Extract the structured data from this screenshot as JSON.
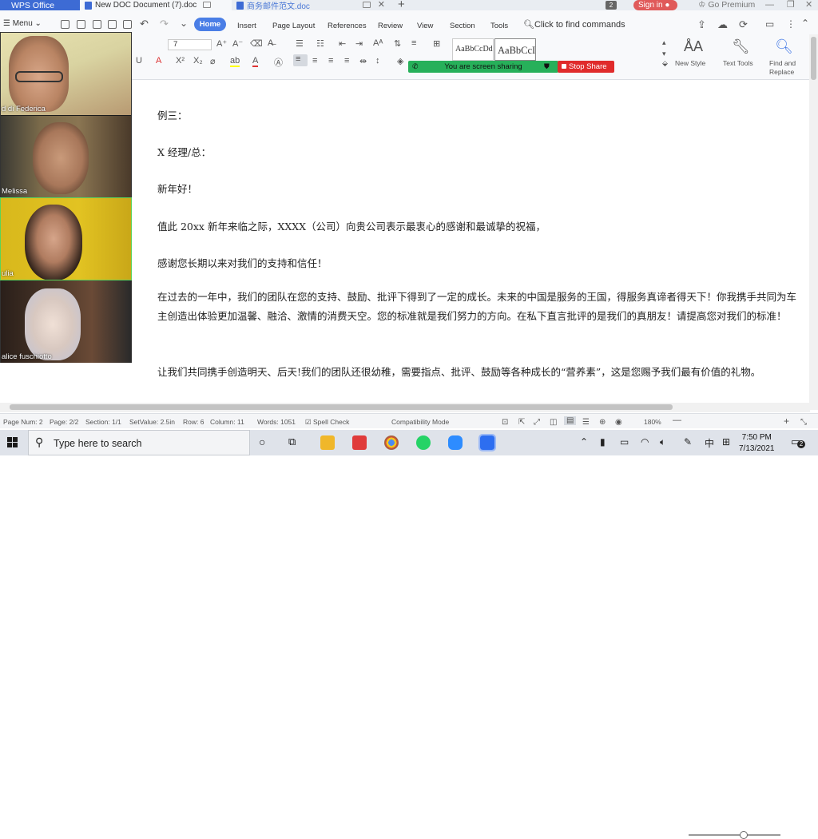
{
  "titlebar": {
    "tabs": [
      {
        "label": "WPS Office"
      },
      {
        "label": "New DOC Document (7).doc"
      },
      {
        "label": "商务邮件范文.doc"
      }
    ],
    "counter_badge": "2",
    "sign_in": "Sign in",
    "premium": "Go Premium"
  },
  "ribbon": {
    "menu_label": "Menu",
    "tabs": [
      "Home",
      "Insert",
      "Page Layout",
      "References",
      "Review",
      "View",
      "Section",
      "Tools"
    ],
    "search_commands": "Click to find commands",
    "font_size": "7",
    "style_samples": [
      "AaBbCcDd",
      "AaBbCcI"
    ],
    "new_style": "New Style",
    "text_tools": "Text Tools",
    "find_replace": [
      "Find and",
      "Replace"
    ]
  },
  "share": {
    "status_text": "You are screen sharing",
    "stop_label": "Stop Share"
  },
  "video_panel": {
    "participants": [
      {
        "name": "d di Federica"
      },
      {
        "name": "Melissa"
      },
      {
        "name": "ulia"
      },
      {
        "name": "alice fuschiotto"
      }
    ]
  },
  "document": {
    "paragraphs": [
      "例三：",
      "X 经理/总：",
      "新年好！",
      "值此 20xx 新年来临之际，XXXX（公司）向贵公司表示最衷心的感谢和最诚挚的祝福，",
      "感谢您长期以来对我们的支持和信任！",
      "在过去的一年中，我们的团队在您的支持、鼓励、批评下得到了一定的成长。未来的中国是服务的王国，得服务真谛者得天下！你我携手共同为车主创造出体验更加温馨、融洽、激情的消费天空。您的标准就是我们努力的方向。在私下直言批评的是我们的真朋友！请提高您对我们的标准！",
      "让我们共同携手创造明天、后天!我们的团队还很幼稚，需要指点、批评、鼓励等各种成长的“营养素”，这是您赐予我们最有价值的礼物。"
    ]
  },
  "statusbar": {
    "page_num": "Page Num: 2",
    "page": "Page: 2/2",
    "section": "Section: 1/1",
    "setvalue": "SetValue: 2.5in",
    "row": "Row: 6",
    "column": "Column: 11",
    "words": "Words: 1051",
    "spell_check": "Spell Check",
    "compat": "Compatibility Mode",
    "zoom": "180%",
    "zoom_level": 0.6
  },
  "taskbar": {
    "search_placeholder": "Type here to search",
    "ime": "中",
    "time": "7:50 PM",
    "date": "7/13/2021",
    "notif_count": "2"
  },
  "colors": {
    "accent": "#4a7ee6",
    "share_green": "#27b05a",
    "stop_red": "#e02b2b",
    "wps_tab": "#3d6bd4"
  }
}
